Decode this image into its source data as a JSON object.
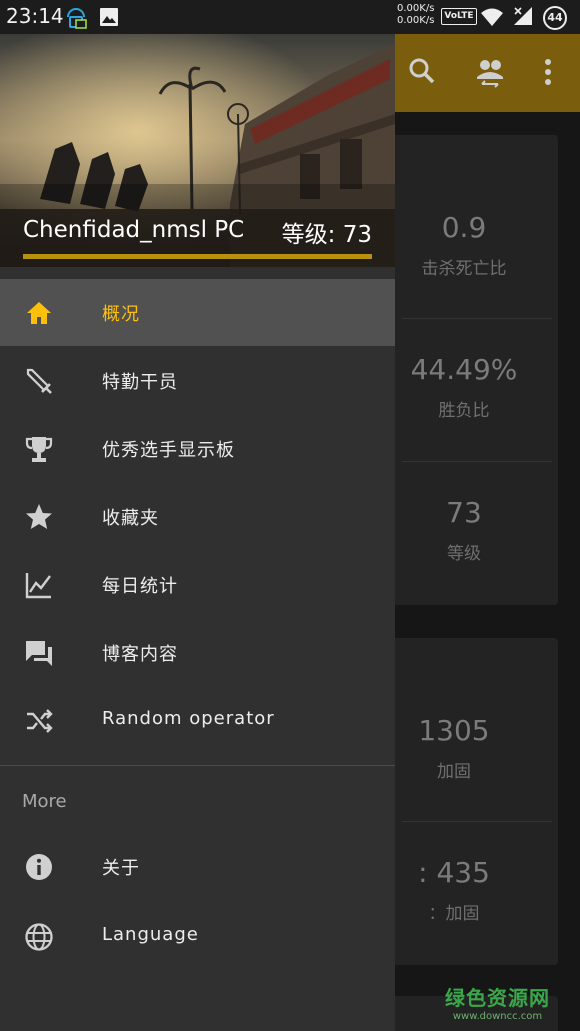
{
  "status_bar": {
    "time": "23:14",
    "speed_up": "0.00K/s",
    "speed_down": "0.00K/s",
    "volte": "VoLTE",
    "battery": "44"
  },
  "profile": {
    "name": "Chenfidad_nmsl PC",
    "level_text": "等级: 73"
  },
  "nav": {
    "items": [
      {
        "label": "概况",
        "icon": "home-icon"
      },
      {
        "label": "特勤干员",
        "icon": "sword-icon"
      },
      {
        "label": "优秀选手显示板",
        "icon": "trophy-icon"
      },
      {
        "label": "收藏夹",
        "icon": "star-icon"
      },
      {
        "label": "每日统计",
        "icon": "chart-icon"
      },
      {
        "label": "博客内容",
        "icon": "chat-icon"
      },
      {
        "label": "Random operator",
        "icon": "shuffle-icon"
      }
    ],
    "more_header": "More",
    "more_items": [
      {
        "label": "关于",
        "icon": "info-icon"
      },
      {
        "label": "Language",
        "icon": "globe-icon"
      }
    ]
  },
  "stats": {
    "kd_value": "0.9",
    "kd_label": "击杀死亡比",
    "wl_value": "44.49%",
    "wl_label": "胜负比",
    "level_value": "73",
    "level_label": "等级",
    "reinforce_value": "1305",
    "reinforce_label": "加固",
    "partial_value": ": 435",
    "partial_label": "：加固"
  },
  "watermark": {
    "title": "绿色资源网",
    "url": "www.downcc.com"
  },
  "colors": {
    "accent": "#ffc107",
    "toolbar": "#7a5e0e",
    "drawer_bg": "#303030",
    "active_bg": "#515151"
  }
}
